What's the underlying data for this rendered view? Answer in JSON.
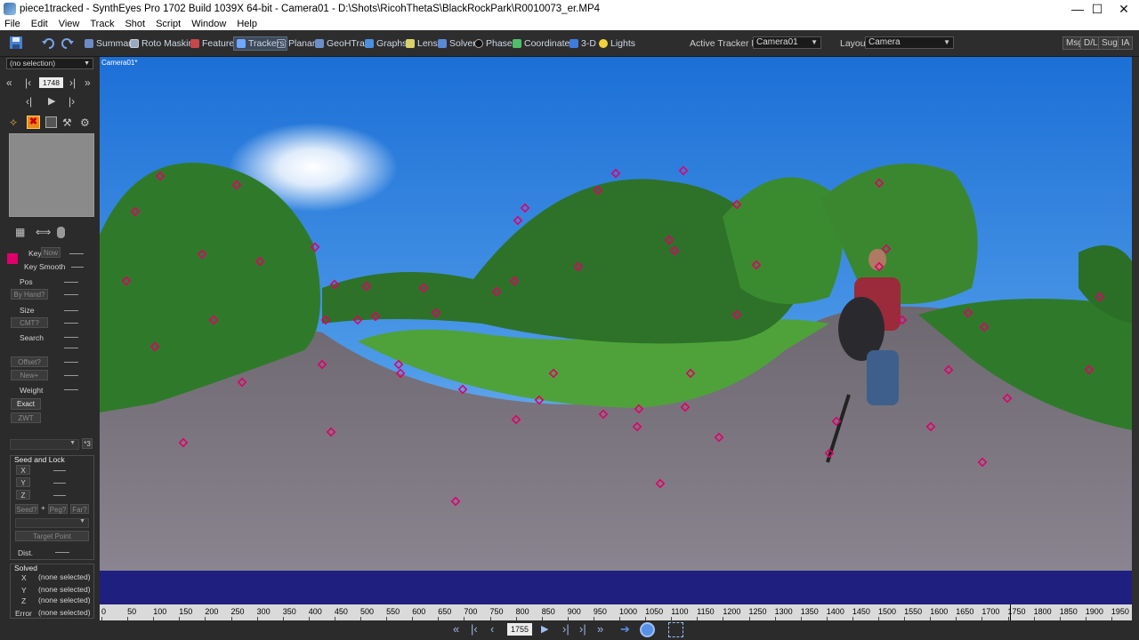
{
  "window": {
    "title": "piece1tracked - SynthEyes Pro 1702 Build 1039X 64-bit - Camera01 - D:\\Shots\\RicohThetaS\\BlackRockPark\\R0010073_er.MP4",
    "minimize": "—",
    "maximize": "☐",
    "close": "✕"
  },
  "menu": [
    "File",
    "Edit",
    "View",
    "Track",
    "Shot",
    "Script",
    "Window",
    "Help"
  ],
  "toolbar": {
    "rooms": [
      "Summary",
      "Roto Masking",
      "Features",
      "Trackers",
      "Planar",
      "GeoHTrack",
      "Graphs",
      "Lens",
      "Solver",
      "Phases",
      "Coordinates",
      "3-D",
      "Lights"
    ],
    "active_room": "Trackers",
    "active_tracker_host_label": "Active Tracker Host:",
    "active_tracker_host_value": "Camera01",
    "layout_label": "Layout:",
    "layout_value": "Camera",
    "right_buttons": [
      "Msg",
      "D/L",
      "Sug",
      "IA"
    ]
  },
  "left": {
    "selection": "(no selection)",
    "frame": "1748",
    "key": "Key",
    "now": "Now",
    "key_smooth": "Key Smooth",
    "pos": "Pos",
    "by_hand": "By Hand?",
    "size": "Size",
    "cmt": "CMT?",
    "search": "Search",
    "offset": "Offset?",
    "new": "New+",
    "weight": "Weight",
    "exact": "Exact",
    "zwt": "ZWT",
    "star3": "*3",
    "seed_and_lock": "Seed and Lock",
    "x": "X",
    "y": "Y",
    "z": "Z",
    "seed": "Seed?",
    "plus": "+",
    "peg": "Peg?",
    "far": "Far?",
    "target_point": "Target Point",
    "dist": "Dist.",
    "solved": "Solved",
    "none_selected": "(none selected)",
    "error": "Error",
    "tracker_color": "#e0006a"
  },
  "viewport": {
    "label": "Camera01*"
  },
  "timeline": {
    "ticks": [
      "0",
      "50",
      "100",
      "150",
      "200",
      "250",
      "300",
      "350",
      "400",
      "450",
      "500",
      "550",
      "600",
      "650",
      "700",
      "750",
      "800",
      "850",
      "900",
      "950",
      "1000",
      "1050",
      "1100",
      "1150",
      "1200",
      "1250",
      "1300",
      "1350",
      "1400",
      "1450",
      "1500",
      "1550",
      "1600",
      "1650",
      "1700",
      "1750",
      "1800",
      "1850",
      "1900",
      "1950"
    ]
  },
  "playback": {
    "frame": "1755"
  }
}
